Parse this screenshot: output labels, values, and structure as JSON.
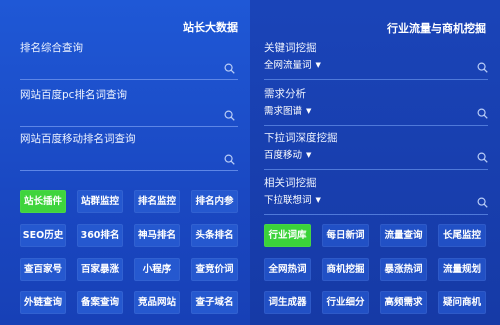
{
  "left_panel": {
    "title": "站长大数据",
    "search_rows": [
      {
        "label": "排名综合查询"
      },
      {
        "label": "网站百度pc排名词查询"
      },
      {
        "label": "网站百度移动排名词查询"
      }
    ],
    "buttons": [
      {
        "label": "站长插件",
        "active": true
      },
      {
        "label": "站群监控",
        "active": false
      },
      {
        "label": "排名监控",
        "active": false
      },
      {
        "label": "排名内参",
        "active": false
      },
      {
        "label": "SEO历史",
        "active": false
      },
      {
        "label": "360排名",
        "active": false
      },
      {
        "label": "神马排名",
        "active": false
      },
      {
        "label": "头条排名",
        "active": false
      },
      {
        "label": "查百家号",
        "active": false
      },
      {
        "label": "百家暴涨",
        "active": false
      },
      {
        "label": "小程序",
        "active": false
      },
      {
        "label": "查竞价词",
        "active": false
      },
      {
        "label": "外链查询",
        "active": false
      },
      {
        "label": "备案查询",
        "active": false
      },
      {
        "label": "竞品网站",
        "active": false
      },
      {
        "label": "查子域名",
        "active": false
      }
    ]
  },
  "right_panel": {
    "title": "行业流量与商机挖掘",
    "search_rows": [
      {
        "label": "关键词挖掘",
        "dropdown": "全网流量词"
      },
      {
        "label": "需求分析",
        "dropdown": "需求图谱"
      },
      {
        "label": "下拉词深度挖掘",
        "dropdown": "百度移动"
      },
      {
        "label": "相关词挖掘",
        "dropdown": "下拉联想词"
      }
    ],
    "buttons": [
      {
        "label": "行业词库",
        "active": true
      },
      {
        "label": "每日新词",
        "active": false
      },
      {
        "label": "流量查询",
        "active": false
      },
      {
        "label": "长尾监控",
        "active": false
      },
      {
        "label": "全网热词",
        "active": false
      },
      {
        "label": "商机挖掘",
        "active": false
      },
      {
        "label": "暴涨热词",
        "active": false
      },
      {
        "label": "流量规划",
        "active": false
      },
      {
        "label": "词生成器",
        "active": false
      },
      {
        "label": "行业细分",
        "active": false
      },
      {
        "label": "高频需求",
        "active": false
      },
      {
        "label": "疑问商机",
        "active": false
      }
    ]
  },
  "colors": {
    "accent_green": "#3fd43d",
    "panel_blue": "#1f58d6",
    "button_blue": "#2558cf"
  }
}
